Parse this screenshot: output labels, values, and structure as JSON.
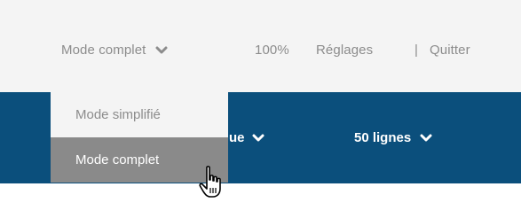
{
  "topbar": {
    "mode_label": "Mode complet",
    "zoom": "100%",
    "settings": "Réglages",
    "separator": "|",
    "quit": "Quitter"
  },
  "bluebar": {
    "partial_label": "ue",
    "lines_label": "50 lignes"
  },
  "dropdown": {
    "options": [
      "Mode simplifié",
      "Mode complet"
    ],
    "hovered": "Mode complet"
  },
  "icons": {
    "chevron_down": "chevron-down-icon",
    "cursor": "hand-pointer-icon"
  },
  "colors": {
    "topbar_bg": "#f4f4f4",
    "bluebar_bg": "#0b4f7c",
    "hover_bg": "#8a8a8a",
    "text_muted": "#8c8c8c"
  }
}
